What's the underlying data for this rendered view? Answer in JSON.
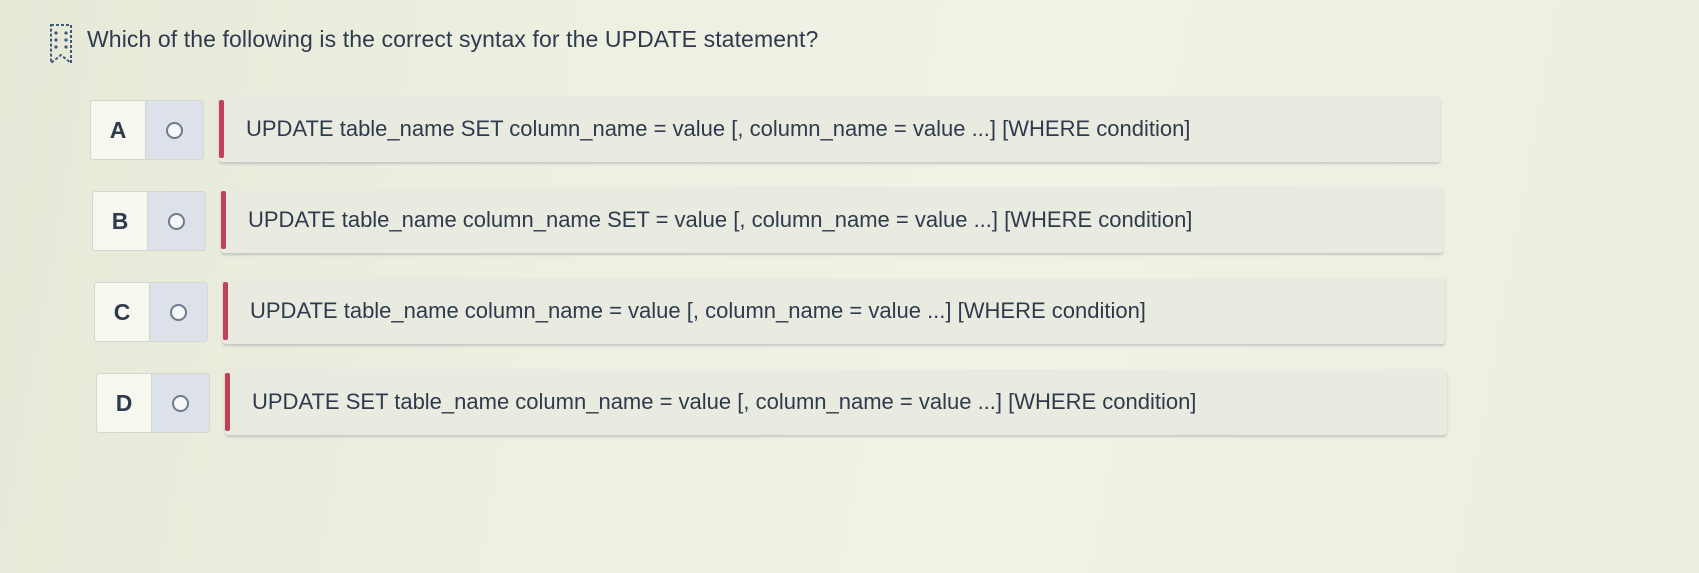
{
  "question": {
    "text": "Which of the following is the correct syntax for the UPDATE statement?",
    "icon": "bookmark-icon"
  },
  "options": [
    {
      "letter": "A",
      "text": "UPDATE table_name SET column_name = value [, column_name = value ...] [WHERE condition]"
    },
    {
      "letter": "B",
      "text": "UPDATE table_name column_name SET = value [, column_name = value ...] [WHERE condition]"
    },
    {
      "letter": "C",
      "text": "UPDATE table_name column_name = value [, column_name = value ...] [WHERE condition]"
    },
    {
      "letter": "D",
      "text": "UPDATE SET table_name column_name = value [, column_name = value ...] [WHERE condition]"
    }
  ],
  "colors": {
    "accent_bar": "#c0425a",
    "radio_bg": "#dde2ea",
    "text": "#2e3b4c"
  }
}
